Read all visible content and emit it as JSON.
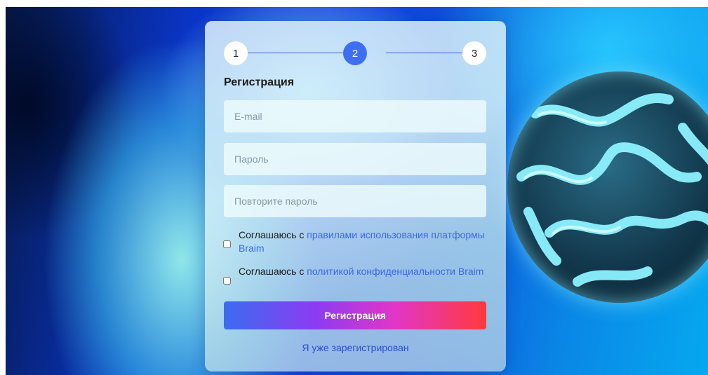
{
  "stepper": {
    "steps": [
      "1",
      "2",
      "3"
    ],
    "active_step": 2
  },
  "form": {
    "title": "Регистрация",
    "email_placeholder": "E-mail",
    "password_placeholder": "Пароль",
    "repeat_password_placeholder": "Повторите пароль",
    "terms": {
      "prefix": "Соглашаюсь с ",
      "link": "правилами использования платформы Braim",
      "checked": false
    },
    "privacy": {
      "prefix": "Соглашаюсь с ",
      "link": "политикой конфиденциальности Braim",
      "checked": false
    },
    "submit_label": "Регистрация",
    "login_link": "Я уже зарегистрирован"
  },
  "colors": {
    "accent": "#3d6ff2",
    "link": "#3b68e0",
    "button_gradient": [
      "#3a6cf0",
      "#8b3cf2",
      "#e236c8",
      "#ff3a3a"
    ]
  }
}
